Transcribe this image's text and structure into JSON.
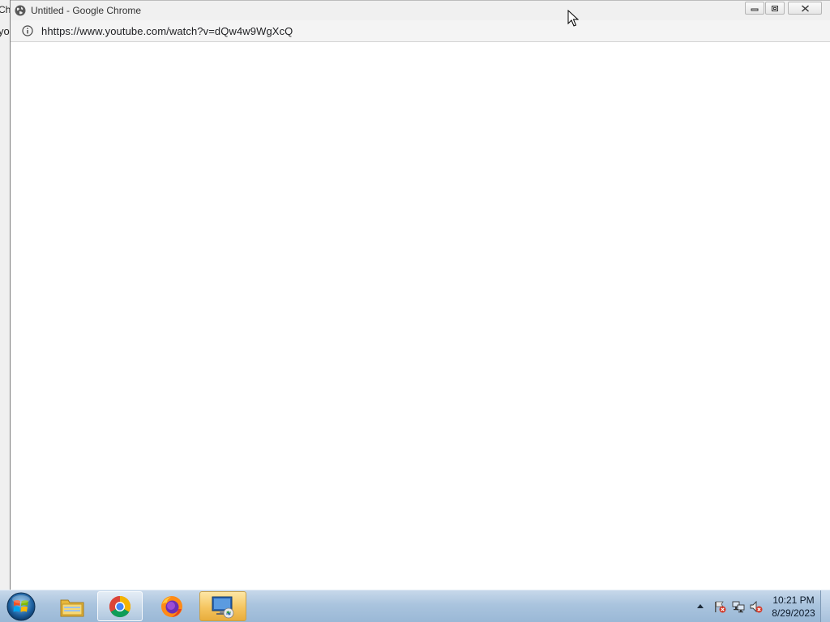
{
  "background_window": {
    "title_fragment": "Ch",
    "address_fragment": "yo"
  },
  "window": {
    "title": "Untitled - Google Chrome",
    "url": "hhttps://www.youtube.com/watch?v=dQw4w9WgXcQ",
    "controls": [
      "minimize",
      "restore",
      "close"
    ]
  },
  "taskbar": {
    "start_icon": "windows-logo-icon",
    "items": [
      {
        "name": "file-explorer",
        "icon": "folder-icon",
        "state": "pinned"
      },
      {
        "name": "google-chrome",
        "icon": "chrome-icon",
        "state": "running"
      },
      {
        "name": "firefox",
        "icon": "firefox-icon",
        "state": "pinned"
      },
      {
        "name": "remote-desktop",
        "icon": "remote-desktop-icon",
        "state": "active"
      }
    ],
    "clock": {
      "time": "10:21 PM",
      "date": "8/29/2023"
    }
  },
  "colors": {
    "taskbar": "#aac4de",
    "titlebar": "#f0f0f0",
    "active_item": "#f5c560",
    "close_x": "#d23a2a"
  }
}
